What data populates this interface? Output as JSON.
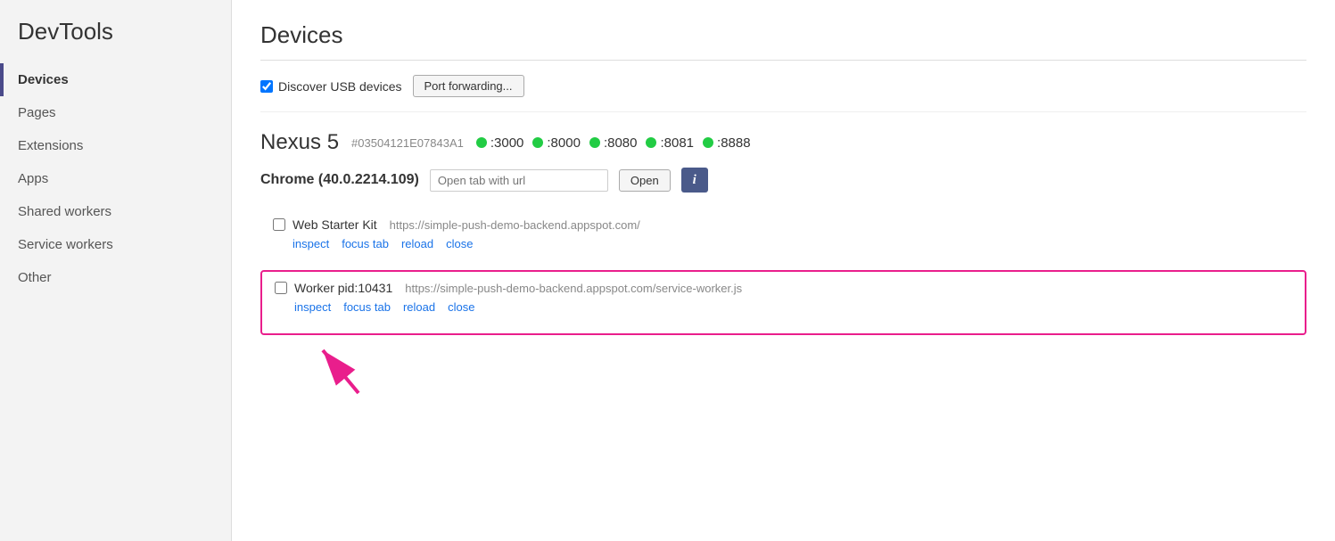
{
  "sidebar": {
    "title": "DevTools",
    "items": [
      {
        "label": "Devices",
        "active": true
      },
      {
        "label": "Pages",
        "active": false
      },
      {
        "label": "Extensions",
        "active": false
      },
      {
        "label": "Apps",
        "active": false
      },
      {
        "label": "Shared workers",
        "active": false
      },
      {
        "label": "Service workers",
        "active": false
      },
      {
        "label": "Other",
        "active": false
      }
    ]
  },
  "main": {
    "title": "Devices",
    "toolbar": {
      "checkbox_label": "Discover USB devices",
      "checkbox_checked": true,
      "port_forwarding_label": "Port forwarding..."
    },
    "device": {
      "name": "Nexus 5",
      "id": "#03504121E07843A1",
      "ports": [
        ":3000",
        ":8000",
        ":8080",
        ":8081",
        ":8888"
      ]
    },
    "chrome": {
      "label": "Chrome (40.0.2214.109)",
      "url_placeholder": "Open tab with url",
      "open_label": "Open",
      "info_label": "i"
    },
    "tabs": [
      {
        "name": "Web Starter Kit",
        "url": "https://simple-push-demo-backend.appspot.com/",
        "actions": [
          "inspect",
          "focus tab",
          "reload",
          "close"
        ],
        "highlighted": false
      }
    ],
    "worker": {
      "name": "Worker pid:10431",
      "url": "https://simple-push-demo-backend.appspot.com/service-worker.js",
      "actions": [
        "inspect",
        "focus tab",
        "reload",
        "close"
      ],
      "highlighted": true
    }
  }
}
